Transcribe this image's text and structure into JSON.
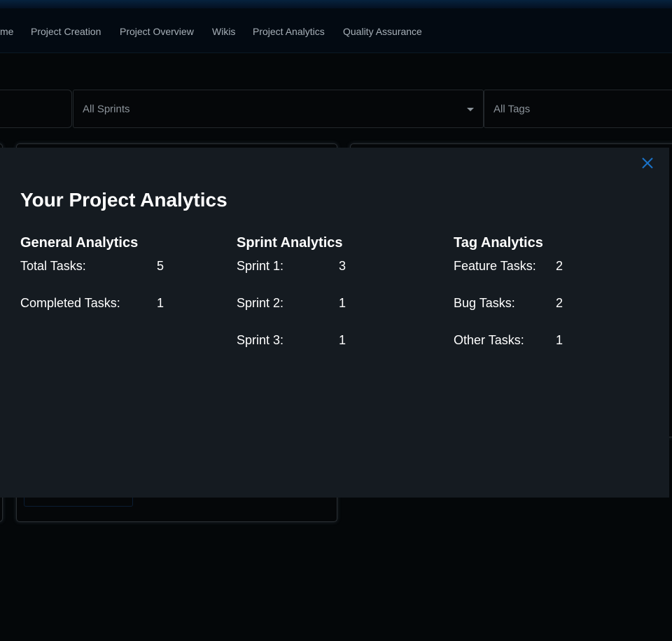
{
  "nav": {
    "items": [
      {
        "label": "me"
      },
      {
        "label": "Project Creation"
      },
      {
        "label": "Project Overview"
      },
      {
        "label": "Wikis"
      },
      {
        "label": "Project Analytics"
      },
      {
        "label": "Quality Assurance"
      }
    ]
  },
  "filters": {
    "sprints_value": "All Sprints",
    "tags_value": "All Tags"
  },
  "modal": {
    "title": "Your Project Analytics",
    "close_icon": "close-icon",
    "accent_color": "#1a73c9",
    "general": {
      "heading": "General Analytics",
      "rows": [
        {
          "label": "Total Tasks:",
          "value": "5"
        },
        {
          "label": "Completed Tasks:",
          "value": "1"
        }
      ]
    },
    "sprint": {
      "heading": "Sprint Analytics",
      "rows": [
        {
          "label": "Sprint 1:",
          "value": "3"
        },
        {
          "label": "Sprint 2:",
          "value": "1"
        },
        {
          "label": "Sprint 3:",
          "value": "1"
        }
      ]
    },
    "tag": {
      "heading": "Tag Analytics",
      "rows": [
        {
          "label": "Feature Tasks:",
          "value": "2"
        },
        {
          "label": "Bug Tasks:",
          "value": "2"
        },
        {
          "label": "Other Tasks:",
          "value": "1"
        }
      ]
    }
  }
}
